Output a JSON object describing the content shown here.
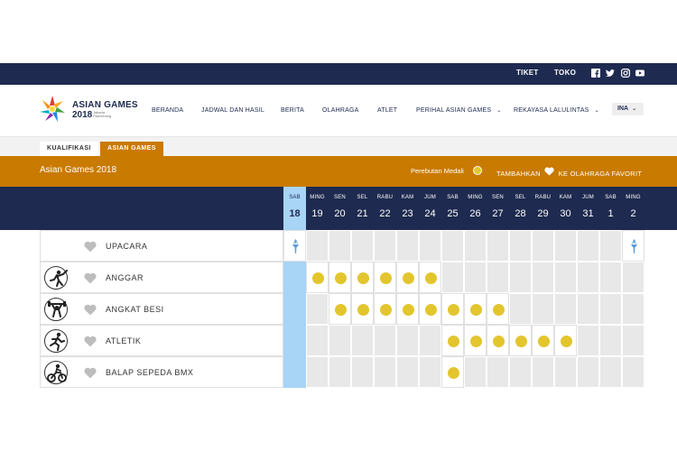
{
  "topbar": {
    "links": [
      "TIKET",
      "TOKO"
    ],
    "social_icons": [
      "facebook-icon",
      "twitter-icon",
      "instagram-icon",
      "youtube-icon"
    ]
  },
  "brand": {
    "line1": "ASIAN GAMES",
    "line2": "2018",
    "sub1": "Jakarta",
    "sub2": "Palembang"
  },
  "nav": {
    "items": [
      "BERANDA",
      "JADWAL DAN HASIL",
      "BERITA",
      "OLAHRAGA",
      "ATLET",
      "PERIHAL ASIAN GAMES",
      "REKAYASA LALULINTAS"
    ],
    "language": "INA"
  },
  "tabs": [
    "KUALIFIKASI",
    "ASIAN GAMES"
  ],
  "section": {
    "title": "Asian Games 2018",
    "medal_label": "Perebutan Medali",
    "favorite_prefix": "TAMBAHKAN",
    "favorite_suffix": "KE OLAHRAGA FAVORIT"
  },
  "colors": {
    "navy": "#1e2a4f",
    "orange": "#c97a00",
    "gold": "#e3c52e",
    "selected_day": "#a8d4f5"
  },
  "dates": [
    {
      "wd": "SAB",
      "d": "18"
    },
    {
      "wd": "MING",
      "d": "19"
    },
    {
      "wd": "SEN",
      "d": "20"
    },
    {
      "wd": "SEL",
      "d": "21"
    },
    {
      "wd": "RABU",
      "d": "22"
    },
    {
      "wd": "KAM",
      "d": "23"
    },
    {
      "wd": "JUM",
      "d": "24"
    },
    {
      "wd": "SAB",
      "d": "25"
    },
    {
      "wd": "MING",
      "d": "26"
    },
    {
      "wd": "SEN",
      "d": "27"
    },
    {
      "wd": "SEL",
      "d": "28"
    },
    {
      "wd": "RABU",
      "d": "29"
    },
    {
      "wd": "KAM",
      "d": "30"
    },
    {
      "wd": "JUM",
      "d": "31"
    },
    {
      "wd": "SAB",
      "d": "1"
    },
    {
      "wd": "MING",
      "d": "2"
    }
  ],
  "selected_index": 0,
  "sports": [
    {
      "name": "UPACARA",
      "icon": "ceremony",
      "active": [
        0,
        15
      ],
      "medals": [],
      "torch": [
        0,
        15
      ]
    },
    {
      "name": "ANGGAR",
      "icon": "fencing-icon",
      "active": [
        1,
        2,
        3,
        4,
        5,
        6
      ],
      "medals": [
        1,
        2,
        3,
        4,
        5,
        6
      ],
      "torch": []
    },
    {
      "name": "ANGKAT BESI",
      "icon": "weightlifting-icon",
      "active": [
        2,
        3,
        4,
        5,
        6,
        7,
        8,
        9
      ],
      "medals": [
        2,
        3,
        4,
        5,
        6,
        7,
        8,
        9
      ],
      "torch": []
    },
    {
      "name": "ATLETIK",
      "icon": "athletics-icon",
      "active": [
        7,
        8,
        9,
        10,
        11,
        12
      ],
      "medals": [
        7,
        8,
        9,
        10,
        11,
        12
      ],
      "torch": []
    },
    {
      "name": "BALAP SEPEDA BMX",
      "icon": "bmx-icon",
      "active": [
        7
      ],
      "medals": [
        7
      ],
      "torch": []
    }
  ]
}
